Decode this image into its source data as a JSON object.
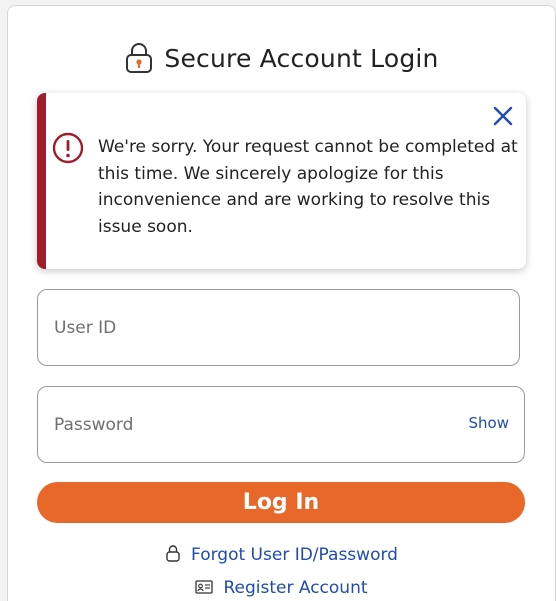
{
  "header": {
    "title": "Secure Account Login",
    "icon": "padlock-icon",
    "accent_color": "#e8682a"
  },
  "alert": {
    "message": "We're sorry. Your request cannot be completed at this time. We sincerely apologize for this inconvenience and are working to resolve this issue soon.",
    "icon": "error-circle-icon",
    "close_icon": "close-icon",
    "color": "#a11d2e"
  },
  "form": {
    "user_id": {
      "placeholder": "User ID",
      "value": ""
    },
    "password": {
      "placeholder": "Password",
      "value": "",
      "show_label": "Show"
    },
    "login_label": "Log In",
    "login_color": "#e8682a"
  },
  "links": {
    "forgot": {
      "label": "Forgot User ID/Password",
      "icon": "lock-icon"
    },
    "register": {
      "label": "Register Account",
      "icon": "id-card-icon"
    },
    "color": "#1f4bb3"
  }
}
